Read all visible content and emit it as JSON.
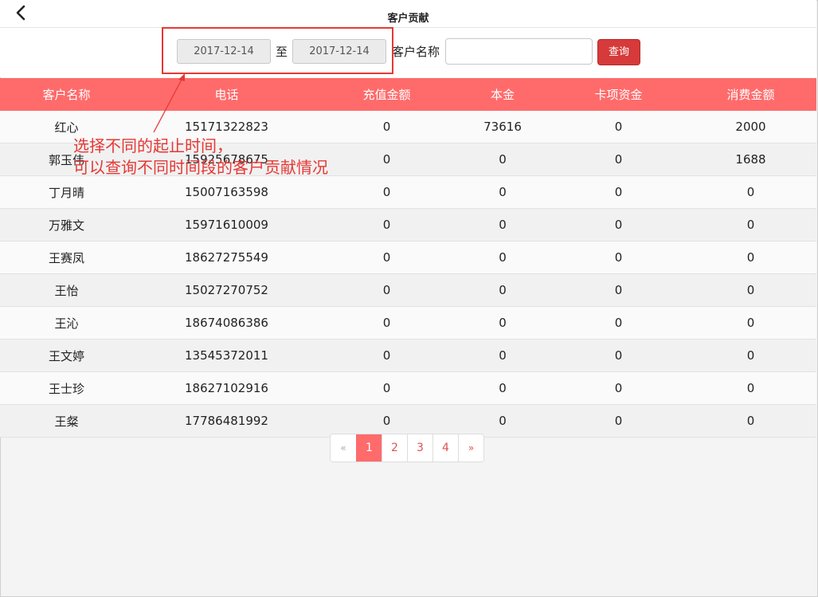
{
  "header": {
    "title": "客户贡献"
  },
  "filter": {
    "start_date": "2017-12-14",
    "separator": "至",
    "end_date": "2017-12-14",
    "name_label": "客户名称",
    "name_value": "",
    "query_label": "查询"
  },
  "table": {
    "columns": [
      "客户名称",
      "电话",
      "充值金额",
      "本金",
      "卡项资金",
      "消费金额"
    ],
    "rows": [
      [
        "红心",
        "15171322823",
        "0",
        "73616",
        "0",
        "2000"
      ],
      [
        "郭玉伟",
        "15925678675",
        "0",
        "0",
        "0",
        "1688"
      ],
      [
        "丁月晴",
        "15007163598",
        "0",
        "0",
        "0",
        "0"
      ],
      [
        "万雅文",
        "15971610009",
        "0",
        "0",
        "0",
        "0"
      ],
      [
        "王赛凤",
        "18627275549",
        "0",
        "0",
        "0",
        "0"
      ],
      [
        "王怡",
        "15027270752",
        "0",
        "0",
        "0",
        "0"
      ],
      [
        "王沁",
        "18674086386",
        "0",
        "0",
        "0",
        "0"
      ],
      [
        "王文婷",
        "13545372011",
        "0",
        "0",
        "0",
        "0"
      ],
      [
        "王士珍",
        "18627102916",
        "0",
        "0",
        "0",
        "0"
      ],
      [
        "王粲",
        "17786481992",
        "0",
        "0",
        "0",
        "0"
      ]
    ]
  },
  "pagination": {
    "prev": "«",
    "pages": [
      "1",
      "2",
      "3",
      "4"
    ],
    "next": "»",
    "current": 1
  },
  "annotation": {
    "line1": "选择不同的起止时间，",
    "line2": "可以查询不同时间段的客户贡献情况"
  },
  "colors": {
    "header_row": "#ff6b6b",
    "query_button": "#d63a3a",
    "annotation": "#e53935"
  }
}
